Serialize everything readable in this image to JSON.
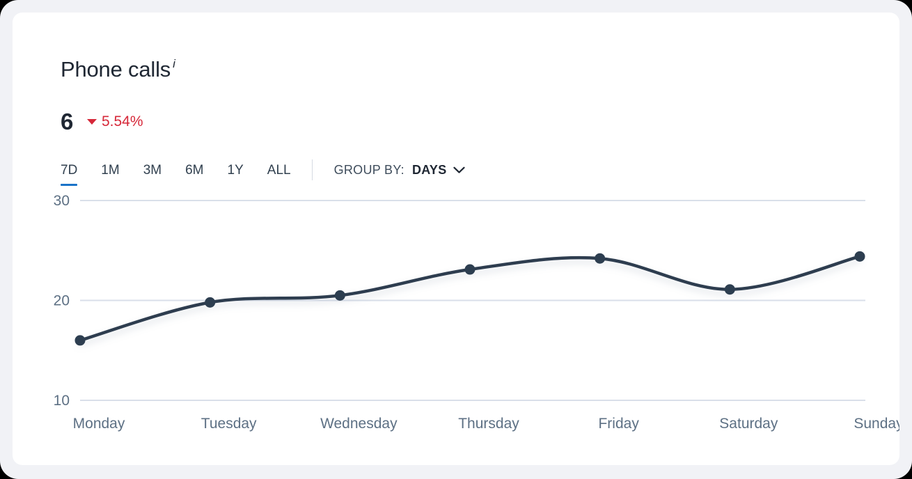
{
  "card": {
    "title": "Phone calls",
    "info_indicator": "i",
    "metric_value": "6",
    "delta": {
      "direction": "down",
      "arrow_icon": "triangle-down-icon",
      "text": "5.54%",
      "color": "#d62839"
    }
  },
  "controls": {
    "range_tabs": [
      {
        "label": "7D",
        "active": true
      },
      {
        "label": "1M",
        "active": false
      },
      {
        "label": "3M",
        "active": false
      },
      {
        "label": "6M",
        "active": false
      },
      {
        "label": "1Y",
        "active": false
      },
      {
        "label": "ALL",
        "active": false
      }
    ],
    "active_tab_color": "#1a73c8",
    "group_by": {
      "label": "GROUP BY:",
      "value": "DAYS",
      "chevron_icon": "chevron-down-icon"
    }
  },
  "chart_data": {
    "type": "line",
    "title": "Phone calls",
    "xlabel": "",
    "ylabel": "",
    "categories": [
      "Monday",
      "Tuesday",
      "Wednesday",
      "Thursday",
      "Friday",
      "Saturday",
      "Sunday"
    ],
    "series": [
      {
        "name": "Phone calls",
        "values": [
          16.0,
          19.8,
          20.5,
          23.1,
          24.2,
          21.1,
          24.4
        ],
        "color": "#2d3e50",
        "marker": "circle",
        "curve": "smooth"
      }
    ],
    "ylim": [
      10,
      30
    ],
    "yticks": [
      10,
      20,
      30
    ],
    "ytick_labels": [
      "10",
      "20",
      "30"
    ],
    "grid": true,
    "gridline_color": "#d9dfe9",
    "legend": "none",
    "axis_label_color": "#5d7084"
  }
}
